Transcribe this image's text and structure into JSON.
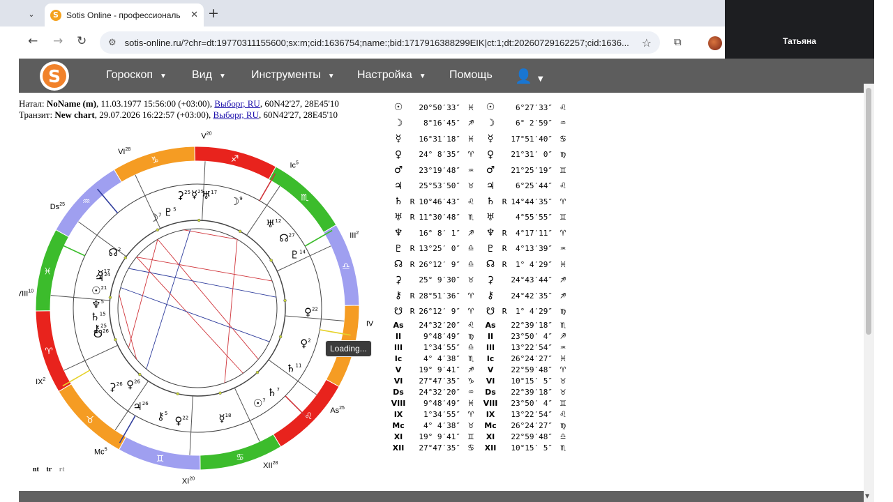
{
  "browser": {
    "tab_title": "Sotis Online - профессиональ",
    "url": "sotis-online.ru/?chr=dt:19770311155600;sx:m;cid:1636754;name:;bid:1717916388299EIK|ct:1;dt:20260729162257;cid:1636...",
    "video_participant": "Татьяна"
  },
  "nav": {
    "horoscope": "Гороскоп",
    "view": "Вид",
    "tools": "Инструменты",
    "settings": "Настройка",
    "help": "Помощь"
  },
  "natal": {
    "prefix": "Натал:",
    "name": "NoName (m)",
    "date": ", 11.03.1977 15:56:00 (+03:00), ",
    "city": "Выборг, RU",
    "coords": ", 60N42'27, 28E45'10"
  },
  "transit": {
    "prefix": "Транзит:",
    "name": "New chart",
    "date": ", 29.07.2026 16:22:57 (+03:00), ",
    "city": "Выборг, RU",
    "coords": ", 60N42'27, 28E45'10"
  },
  "loading": "Loading...",
  "bottom_links": [
    "nt",
    "tr",
    "rt"
  ],
  "colors": {
    "fire": "#e8231d",
    "earth": "#f59c23",
    "air": "#9f9ff0",
    "water": "#3cbc2c",
    "aspect_red": "#d0343a",
    "aspect_blue": "#2e3c9c"
  },
  "chart": {
    "house_labels_outer": [
      "V",
      "Ic",
      "III",
      "IV",
      "As",
      "XII",
      "XI",
      "Mc",
      "IX",
      "VIII",
      "Ds",
      "VI"
    ],
    "house_numbers_outer": [
      "20",
      "5",
      "2",
      "",
      "25",
      "28",
      "20",
      "5",
      "2",
      "10",
      "25",
      "28"
    ],
    "sign_glyphs": [
      "♐",
      "♏",
      "♎",
      "♍",
      "♌",
      "♋",
      "♊",
      "♉",
      "♈",
      "♓",
      "♒",
      "♑"
    ],
    "transit_planets": [
      {
        "glyph": "☿",
        "label": "25"
      },
      {
        "glyph": "⚳",
        "label": "25"
      },
      {
        "glyph": "♅",
        "label": "17"
      },
      {
        "glyph": "☽",
        "label": "9"
      },
      {
        "glyph": "♅",
        "label": "12"
      },
      {
        "glyph": "☊",
        "label": "27"
      },
      {
        "glyph": "♇",
        "label": "14"
      },
      {
        "glyph": "♀",
        "label": "22"
      },
      {
        "glyph": "♀",
        "label": "2"
      },
      {
        "glyph": "♄",
        "label": "7"
      },
      {
        "glyph": "☉",
        "label": "7"
      },
      {
        "glyph": "☿",
        "label": "18"
      },
      {
        "glyph": "♀",
        "label": "22"
      },
      {
        "glyph": "⚷",
        "label": "5"
      },
      {
        "glyph": "♃",
        "label": "26"
      },
      {
        "glyph": "⚳",
        "label": "26"
      },
      {
        "glyph": "♄",
        "label": "11"
      }
    ],
    "natal_planets": [
      {
        "glyph": "☽",
        "label": "7"
      },
      {
        "glyph": "♇",
        "label": "5"
      },
      {
        "glyph": "☊",
        "label": "2"
      },
      {
        "glyph": "♃",
        "label": "24"
      },
      {
        "glyph": "☉",
        "label": "21"
      },
      {
        "glyph": "☿",
        "label": "17"
      },
      {
        "glyph": "♆",
        "label": "5"
      },
      {
        "glyph": "♄",
        "label": "15"
      },
      {
        "glyph": "☋",
        "label": "26"
      },
      {
        "glyph": "⚷",
        "label": "25"
      },
      {
        "glyph": "♀",
        "label": "26"
      }
    ]
  },
  "planet_table": [
    {
      "sym": "☉",
      "r1": "",
      "deg1": "20°50′33″",
      "sign1": "♓",
      "sym2": "☉",
      "r2": "",
      "deg2": "6°27′33″",
      "sign2": "♌"
    },
    {
      "sym": "☽",
      "r1": "",
      "deg1": "8°16′45″",
      "sign1": "♐",
      "sym2": "☽",
      "r2": "",
      "deg2": "6° 2′59″",
      "sign2": "♒"
    },
    {
      "sym": "☿",
      "r1": "",
      "deg1": "16°31′18″",
      "sign1": "♓",
      "sym2": "☿",
      "r2": "",
      "deg2": "17°51′40″",
      "sign2": "♋"
    },
    {
      "sym": "♀",
      "r1": "",
      "deg1": "24° 8′35″",
      "sign1": "♈",
      "sym2": "♀",
      "r2": "",
      "deg2": "21°31′ 0″",
      "sign2": "♍"
    },
    {
      "sym": "♂",
      "r1": "",
      "deg1": "23°19′48″",
      "sign1": "♒",
      "sym2": "♂",
      "r2": "",
      "deg2": "21°25′19″",
      "sign2": "♊"
    },
    {
      "sym": "♃",
      "r1": "",
      "deg1": "25°53′50″",
      "sign1": "♉",
      "sym2": "♃",
      "r2": "",
      "deg2": "6°25′44″",
      "sign2": "♌"
    },
    {
      "sym": "♄",
      "r1": "R",
      "deg1": "10°46′43″",
      "sign1": "♌",
      "sym2": "♄",
      "r2": "R",
      "deg2": "14°44′35″",
      "sign2": "♈"
    },
    {
      "sym": "♅",
      "r1": "R",
      "deg1": "11°30′48″",
      "sign1": "♏",
      "sym2": "♅",
      "r2": "",
      "deg2": "4°55′55″",
      "sign2": "♊"
    },
    {
      "sym": "♆",
      "r1": "",
      "deg1": "16° 8′ 1″",
      "sign1": "♐",
      "sym2": "♆",
      "r2": "R",
      "deg2": "4°17′11″",
      "sign2": "♈"
    },
    {
      "sym": "♇",
      "r1": "R",
      "deg1": "13°25′ 0″",
      "sign1": "♎",
      "sym2": "♇",
      "r2": "R",
      "deg2": "4°13′39″",
      "sign2": "♒"
    },
    {
      "sym": "☊",
      "r1": "R",
      "deg1": "26°12′ 9″",
      "sign1": "♎",
      "sym2": "☊",
      "r2": "R",
      "deg2": "1° 4′29″",
      "sign2": "♓"
    },
    {
      "sym": "⚳",
      "r1": "",
      "deg1": "25° 9′30″",
      "sign1": "♉",
      "sym2": "⚳",
      "r2": "",
      "deg2": "24°43′44″",
      "sign2": "♐"
    },
    {
      "sym": "⚷",
      "r1": "R",
      "deg1": "28°51′36″",
      "sign1": "♈",
      "sym2": "⚷",
      "r2": "",
      "deg2": "24°42′35″",
      "sign2": "♐"
    },
    {
      "sym": "☋",
      "r1": "R",
      "deg1": "26°12′ 9″",
      "sign1": "♈",
      "sym2": "☋",
      "r2": "R",
      "deg2": "1° 4′29″",
      "sign2": "♍"
    }
  ],
  "angle_table": [
    {
      "sym": "As",
      "deg1": "24°32′20″",
      "sign1": "♌",
      "deg2": "22°39′18″",
      "sign2": "♏"
    },
    {
      "sym": "II",
      "deg1": "9°48′49″",
      "sign1": "♍",
      "deg2": "23°50′ 4″",
      "sign2": "♐"
    },
    {
      "sym": "III",
      "deg1": "1°34′55″",
      "sign1": "♎",
      "deg2": "13°22′54″",
      "sign2": "♒"
    },
    {
      "sym": "Ic",
      "deg1": "4° 4′38″",
      "sign1": "♏",
      "deg2": "26°24′27″",
      "sign2": "♓"
    },
    {
      "sym": "V",
      "deg1": "19° 9′41″",
      "sign1": "♐",
      "deg2": "22°59′48″",
      "sign2": "♈"
    },
    {
      "sym": "VI",
      "deg1": "27°47′35″",
      "sign1": "♑",
      "deg2": "10°15′ 5″",
      "sign2": "♉"
    },
    {
      "sym": "Ds",
      "deg1": "24°32′20″",
      "sign1": "♒",
      "deg2": "22°39′18″",
      "sign2": "♉"
    },
    {
      "sym": "VIII",
      "deg1": "9°48′49″",
      "sign1": "♓",
      "deg2": "23°50′ 4″",
      "sign2": "♊"
    },
    {
      "sym": "IX",
      "deg1": "1°34′55″",
      "sign1": "♈",
      "deg2": "13°22′54″",
      "sign2": "♌"
    },
    {
      "sym": "Mc",
      "deg1": "4° 4′38″",
      "sign1": "♉",
      "deg2": "26°24′27″",
      "sign2": "♍"
    },
    {
      "sym": "XI",
      "deg1": "19° 9′41″",
      "sign1": "♊",
      "deg2": "22°59′48″",
      "sign2": "♎"
    },
    {
      "sym": "XII",
      "deg1": "27°47′35″",
      "sign1": "♋",
      "deg2": "10°15′ 5″",
      "sign2": "♏"
    }
  ]
}
